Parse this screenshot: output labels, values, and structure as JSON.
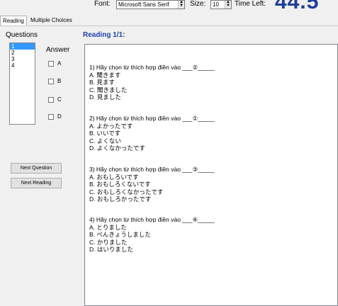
{
  "toolbar": {
    "font_label": "Font:",
    "font_value": "Microsoft Sans Serif",
    "size_label": "Size:",
    "size_value": "10",
    "time_label": "Time Left:",
    "time_value": "44.5"
  },
  "tabs": [
    {
      "label": "Reading",
      "active": true
    },
    {
      "label": "Multiple Choices",
      "active": false
    }
  ],
  "sidebar": {
    "questions_title": "Questions",
    "question_list": [
      "1",
      "2",
      "3",
      "4"
    ],
    "answer_title": "Answer",
    "options": [
      "A",
      "B",
      "C",
      "D"
    ],
    "next_question": "Next Question",
    "next_reading": "Next Reading"
  },
  "reading": {
    "title": "Reading 1/1:",
    "questions": [
      {
        "stem": "1) Hãy chọn từ thích hợp điền vào ___②_____",
        "choices": [
          "A. 聞きます",
          "B. 見ます",
          "C. 聞きました",
          "D. 見ました"
        ]
      },
      {
        "stem": "2) Hãy chọn từ thích hợp điền vào ___①_____",
        "choices": [
          "A. よかったです",
          "B. いいです",
          "C. よくない",
          "D. よくなかったです"
        ]
      },
      {
        "stem": "3) Hãy chọn từ thích hợp điền vào ___③_____",
        "choices": [
          "A. おもしろいです",
          "B. おもしろくないです",
          "C. おもしろくなかったです",
          "D. おもしろかったです"
        ]
      },
      {
        "stem": "4) Hãy chọn từ thích hợp điền vào ___④_____",
        "choices": [
          "A. とりました",
          "B. べんきょうしました",
          "C. かりました",
          "D. はいりました"
        ]
      }
    ]
  }
}
